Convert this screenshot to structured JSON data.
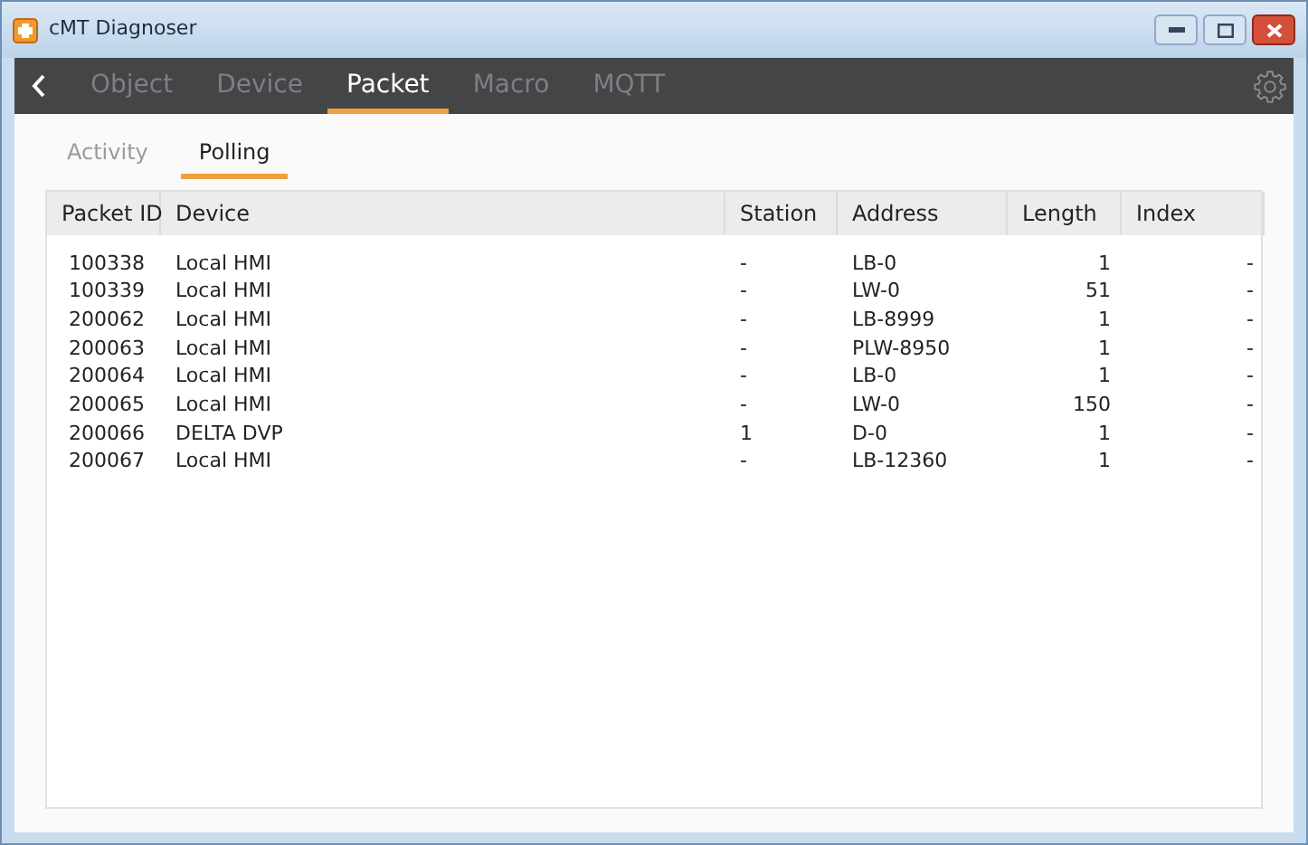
{
  "window": {
    "title": "cMT Diagnoser"
  },
  "tabs": [
    {
      "label": "Object",
      "selected": false
    },
    {
      "label": "Device",
      "selected": false
    },
    {
      "label": "Packet",
      "selected": true
    },
    {
      "label": "Macro",
      "selected": false
    },
    {
      "label": "MQTT",
      "selected": false
    }
  ],
  "subtabs": [
    {
      "label": "Activity",
      "selected": false
    },
    {
      "label": "Polling",
      "selected": true
    }
  ],
  "table": {
    "columns": [
      "Packet ID",
      "Device",
      "Station",
      "Address",
      "Length",
      "Index"
    ],
    "rows": [
      [
        "100338",
        "Local HMI",
        "-",
        "LB-0",
        "1",
        "-"
      ],
      [
        "100339",
        "Local HMI",
        "-",
        "LW-0",
        "51",
        "-"
      ],
      [
        "200062",
        "Local HMI",
        "-",
        "LB-8999",
        "1",
        "-"
      ],
      [
        "200063",
        "Local HMI",
        "-",
        "PLW-8950",
        "1",
        "-"
      ],
      [
        "200064",
        "Local HMI",
        "-",
        "LB-0",
        "1",
        "-"
      ],
      [
        "200065",
        "Local HMI",
        "-",
        "LW-0",
        "150",
        "-"
      ],
      [
        "200066",
        "DELTA DVP",
        "1",
        "D-0",
        "1",
        "-"
      ],
      [
        "200067",
        "Local HMI",
        "-",
        "LB-12360",
        "1",
        "-"
      ]
    ]
  }
}
